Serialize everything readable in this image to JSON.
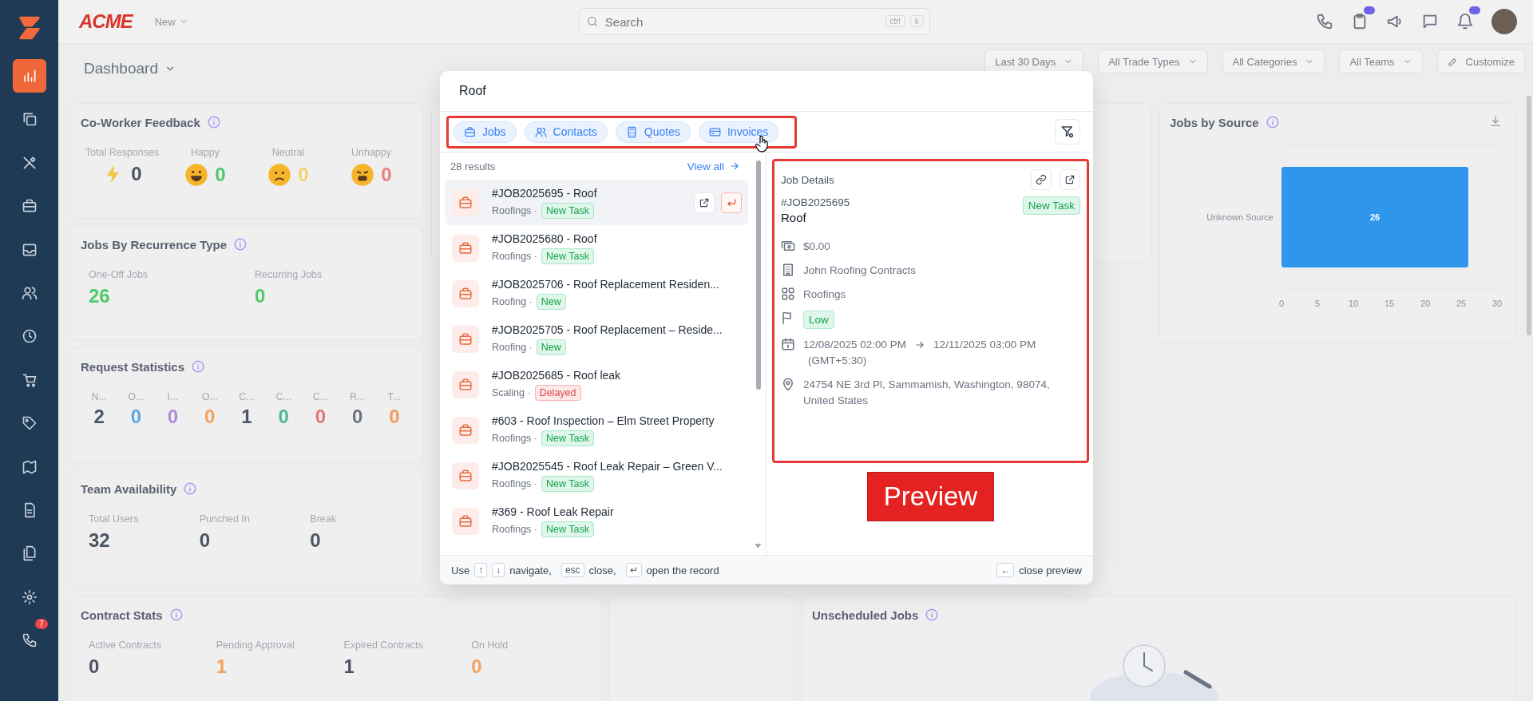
{
  "sidebar": {
    "items": [
      {
        "selected": true
      },
      {
        "selected": false
      },
      {
        "selected": false
      },
      {
        "selected": false
      },
      {
        "selected": false
      },
      {
        "selected": false
      },
      {
        "selected": false
      },
      {
        "selected": false
      },
      {
        "selected": false
      },
      {
        "selected": false
      },
      {
        "selected": false
      },
      {
        "selected": false
      },
      {
        "selected": false
      },
      {
        "selected": false,
        "badge": "7"
      }
    ]
  },
  "header": {
    "logo": "ACME",
    "new_menu": "New",
    "search": {
      "placeholder": "Search",
      "shortcut": [
        "ctrl",
        "k"
      ]
    }
  },
  "toolbar": {
    "title": "Dashboard",
    "filters": [
      "Last 30 Days",
      "All Trade Types",
      "All Categories",
      "All Teams"
    ],
    "customize": "Customize"
  },
  "coworker_feedback": {
    "title": "Co-Worker Feedback",
    "stats": [
      {
        "label": "Total Responses",
        "value": "0",
        "kind": "bolt",
        "color": "#4b5563"
      },
      {
        "label": "Happy",
        "value": "0",
        "kind": "happy",
        "color": "#4ccb6a"
      },
      {
        "label": "Neutral",
        "value": "0",
        "kind": "neutral",
        "color": "#f1d36a"
      },
      {
        "label": "Unhappy",
        "value": "0",
        "kind": "unhappy",
        "color": "#ef7d7d"
      }
    ]
  },
  "recurrence": {
    "title": "Jobs By Recurrence Type",
    "stats": [
      {
        "label": "One-Off Jobs",
        "value": "26",
        "color": "#4ccb6a"
      },
      {
        "label": "Recurring Jobs",
        "value": "0",
        "color": "#4ccb6a"
      }
    ]
  },
  "request_statistics": {
    "title": "Request Statistics",
    "stats": [
      {
        "label": "N...",
        "value": "2",
        "color": "#4b5563"
      },
      {
        "label": "O...",
        "value": "0",
        "color": "#5aa9e6"
      },
      {
        "label": "I...",
        "value": "0",
        "color": "#b388d9"
      },
      {
        "label": "O...",
        "value": "0",
        "color": "#f0a35e"
      },
      {
        "label": "C...",
        "value": "1",
        "color": "#4b5563"
      },
      {
        "label": "C...",
        "value": "0",
        "color": "#4cb59a"
      },
      {
        "label": "C...",
        "value": "0",
        "color": "#e57373"
      },
      {
        "label": "R...",
        "value": "0",
        "color": "#6b7280"
      },
      {
        "label": "T...",
        "value": "0",
        "color": "#f29b5a"
      }
    ]
  },
  "team_availability": {
    "title": "Team Availability",
    "stats": [
      {
        "label": "Total Users",
        "value": "32",
        "color": "#4b5563"
      },
      {
        "label": "Punched In",
        "value": "0",
        "color": "#4b5563"
      },
      {
        "label": "Break",
        "value": "0",
        "color": "#4b5563"
      }
    ]
  },
  "jobs_by_source": {
    "title": "Jobs by Source",
    "chart_data": {
      "type": "bar",
      "orientation": "horizontal",
      "categories": [
        "Unknown Source"
      ],
      "values": [
        26
      ],
      "xlim": [
        0,
        30
      ],
      "xticks": [
        0,
        5,
        10,
        15,
        20,
        25,
        30
      ],
      "data_labels": true
    }
  },
  "contract_stats": {
    "title": "Contract Stats",
    "stats": [
      {
        "label": "Active Contracts",
        "value": "0",
        "color": "#4b5563"
      },
      {
        "label": "Pending Approval",
        "value": "1",
        "color": "#f0a35e"
      },
      {
        "label": "Expired Contracts",
        "value": "1",
        "color": "#4b5563"
      },
      {
        "label": "On Hold",
        "value": "0",
        "color": "#f0a35e"
      }
    ]
  },
  "unscheduled_jobs": {
    "title": "Unscheduled Jobs"
  },
  "search_modal": {
    "query": "Roof",
    "tabs": [
      {
        "label": "Jobs",
        "kind": "jobs"
      },
      {
        "label": "Contacts",
        "kind": "contacts"
      },
      {
        "label": "Quotes",
        "kind": "quotes"
      },
      {
        "label": "Invoices",
        "kind": "invoices"
      }
    ],
    "results_count": "28 results",
    "view_all": "View all",
    "results": [
      {
        "title": "#JOB2025695 - Roof",
        "category": "Roofings ·",
        "status": {
          "label": "New Task",
          "kind": "success"
        },
        "selected": true
      },
      {
        "title": "#JOB2025680 - Roof",
        "category": "Roofings ·",
        "status": {
          "label": "New Task",
          "kind": "success"
        },
        "selected": false
      },
      {
        "title": "#JOB2025706 - Roof Replacement Residen...",
        "category": "Roofing ·",
        "status": {
          "label": "New",
          "kind": "success"
        },
        "selected": false
      },
      {
        "title": "#JOB2025705 - Roof Replacement – Reside...",
        "category": "Roofing ·",
        "status": {
          "label": "New",
          "kind": "success"
        },
        "selected": false
      },
      {
        "title": "#JOB2025685 - Roof leak",
        "category": "Scaling ·",
        "status": {
          "label": "Delayed",
          "kind": "danger"
        },
        "selected": false
      },
      {
        "title": "#603 - Roof Inspection – Elm Street Property",
        "category": "Roofings ·",
        "status": {
          "label": "New Task",
          "kind": "success"
        },
        "selected": false
      },
      {
        "title": "#JOB2025545 - Roof Leak Repair – Green V...",
        "category": "Roofings ·",
        "status": {
          "label": "New Task",
          "kind": "success"
        },
        "selected": false
      },
      {
        "title": "#369 - Roof Leak Repair",
        "category": "Roofings ·",
        "status": {
          "label": "New Task",
          "kind": "success"
        },
        "selected": false
      }
    ],
    "preview": {
      "heading": "Job Details",
      "number": "#JOB2025695",
      "name": "Roof",
      "status": {
        "label": "New Task",
        "kind": "success"
      },
      "fields": [
        {
          "kind": "amount",
          "text": "$0.00"
        },
        {
          "kind": "company",
          "text": "John Roofing Contracts"
        },
        {
          "kind": "category",
          "text": "Roofings"
        },
        {
          "kind": "priority",
          "text": "Low"
        },
        {
          "kind": "schedule",
          "start": "12/08/2025 02:00 PM",
          "end": "12/11/2025 03:00 PM",
          "timezone": "(GMT+5:30)"
        },
        {
          "kind": "address",
          "text": "24754 NE 3rd Pl, Sammamish, Washington, 98074, United States"
        }
      ]
    },
    "footer": {
      "lead": "Use",
      "hints": [
        {
          "keys": [
            "↑",
            "↓"
          ],
          "text": "navigate,"
        },
        {
          "keys": [
            "esc"
          ],
          "text": "close,"
        },
        {
          "keys": [
            "↵"
          ],
          "text": "open the record"
        }
      ],
      "right": {
        "keys": [
          "←"
        ],
        "text": "close preview"
      }
    }
  },
  "annotation": {
    "label": "Preview"
  }
}
